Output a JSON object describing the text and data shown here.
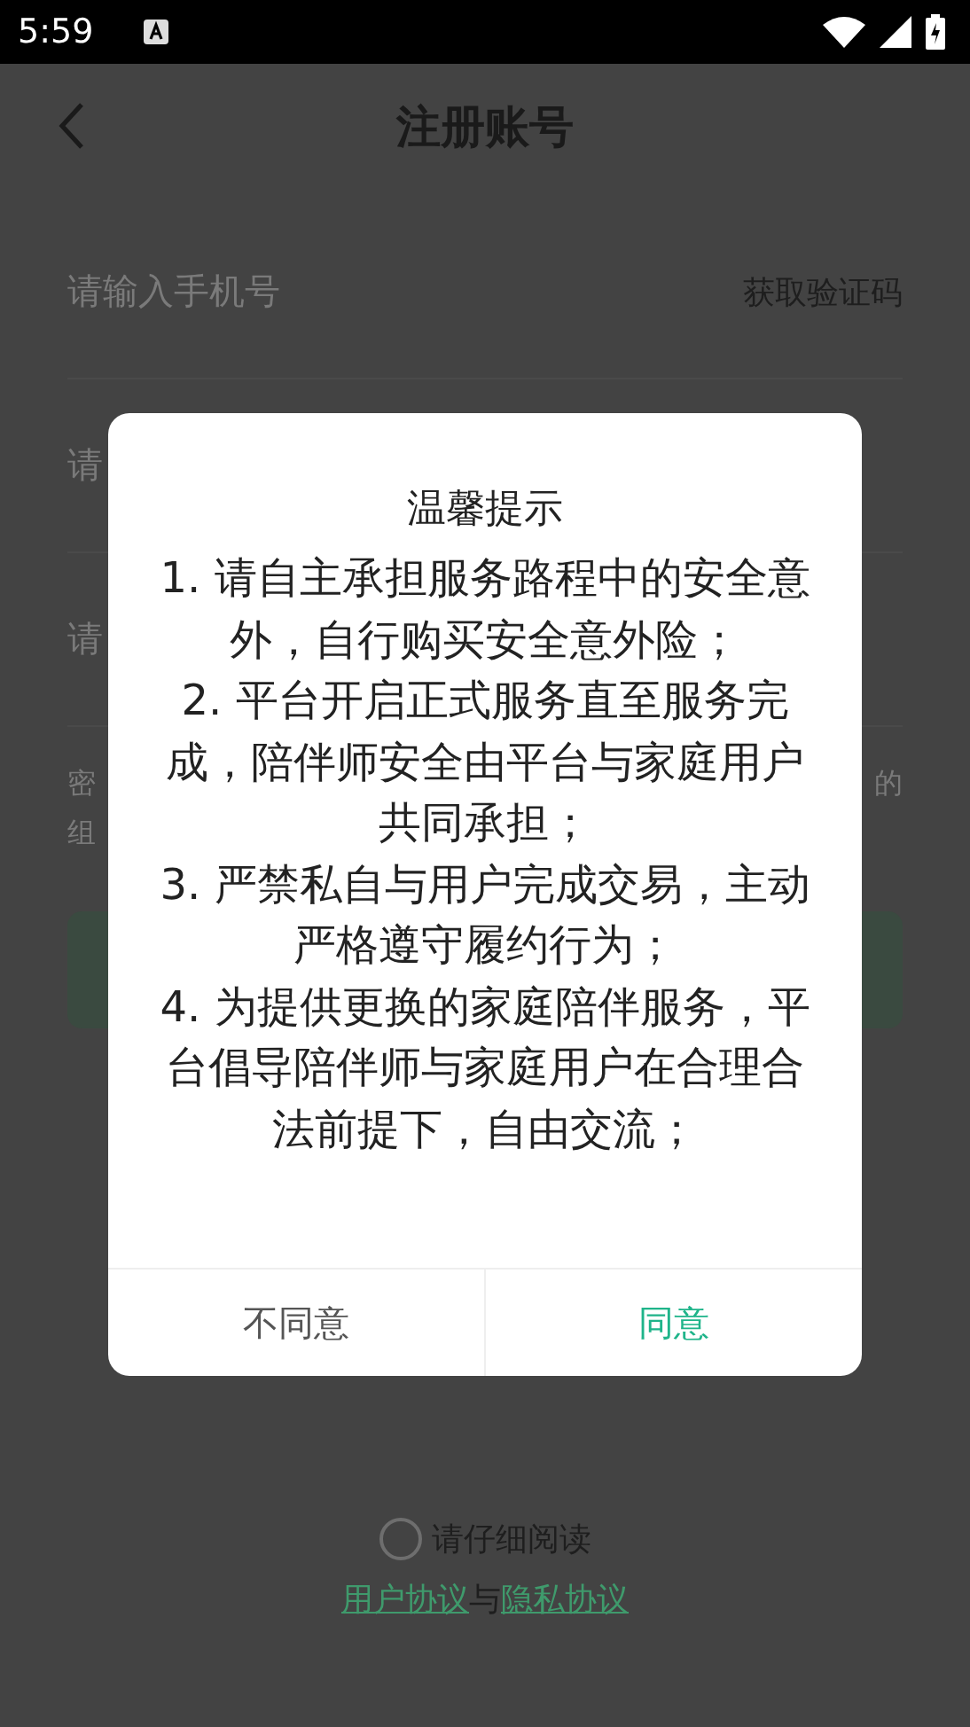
{
  "status_bar": {
    "time": "5:59"
  },
  "header": {
    "title": "注册账号"
  },
  "phone_field": {
    "placeholder": "请输入手机号",
    "code_link": "获取验证码"
  },
  "hidden_fields": [
    {
      "placeholder": "请"
    },
    {
      "placeholder": "请"
    }
  ],
  "note": {
    "line_1_start": "密",
    "line_1_end": "的",
    "line_2_start": "组"
  },
  "agreement": {
    "checked": false,
    "label": "请仔细阅读",
    "links": [
      {
        "kind": "link",
        "text": "用户协议"
      },
      {
        "kind": "plain",
        "text": "与"
      },
      {
        "kind": "link",
        "text": "隐私协议"
      }
    ]
  },
  "dialog": {
    "title": "温馨提示",
    "items": [
      "1. 请自主承担服务路程中的安全意外，自行购买安全意外险；",
      "2. 平台开启正式服务直至服务完成，陪伴师安全由平台与家庭用户共同承担；",
      "3. 严禁私自与用户完成交易，主动严格遵守履约行为；",
      "4. 为提供更换的家庭陪伴服务，平台倡导陪伴师与家庭用户在合理合法前提下，自由交流；"
    ],
    "buttons": [
      {
        "kind": "cancel",
        "label": "不同意"
      },
      {
        "kind": "confirm",
        "label": "同意"
      }
    ]
  }
}
